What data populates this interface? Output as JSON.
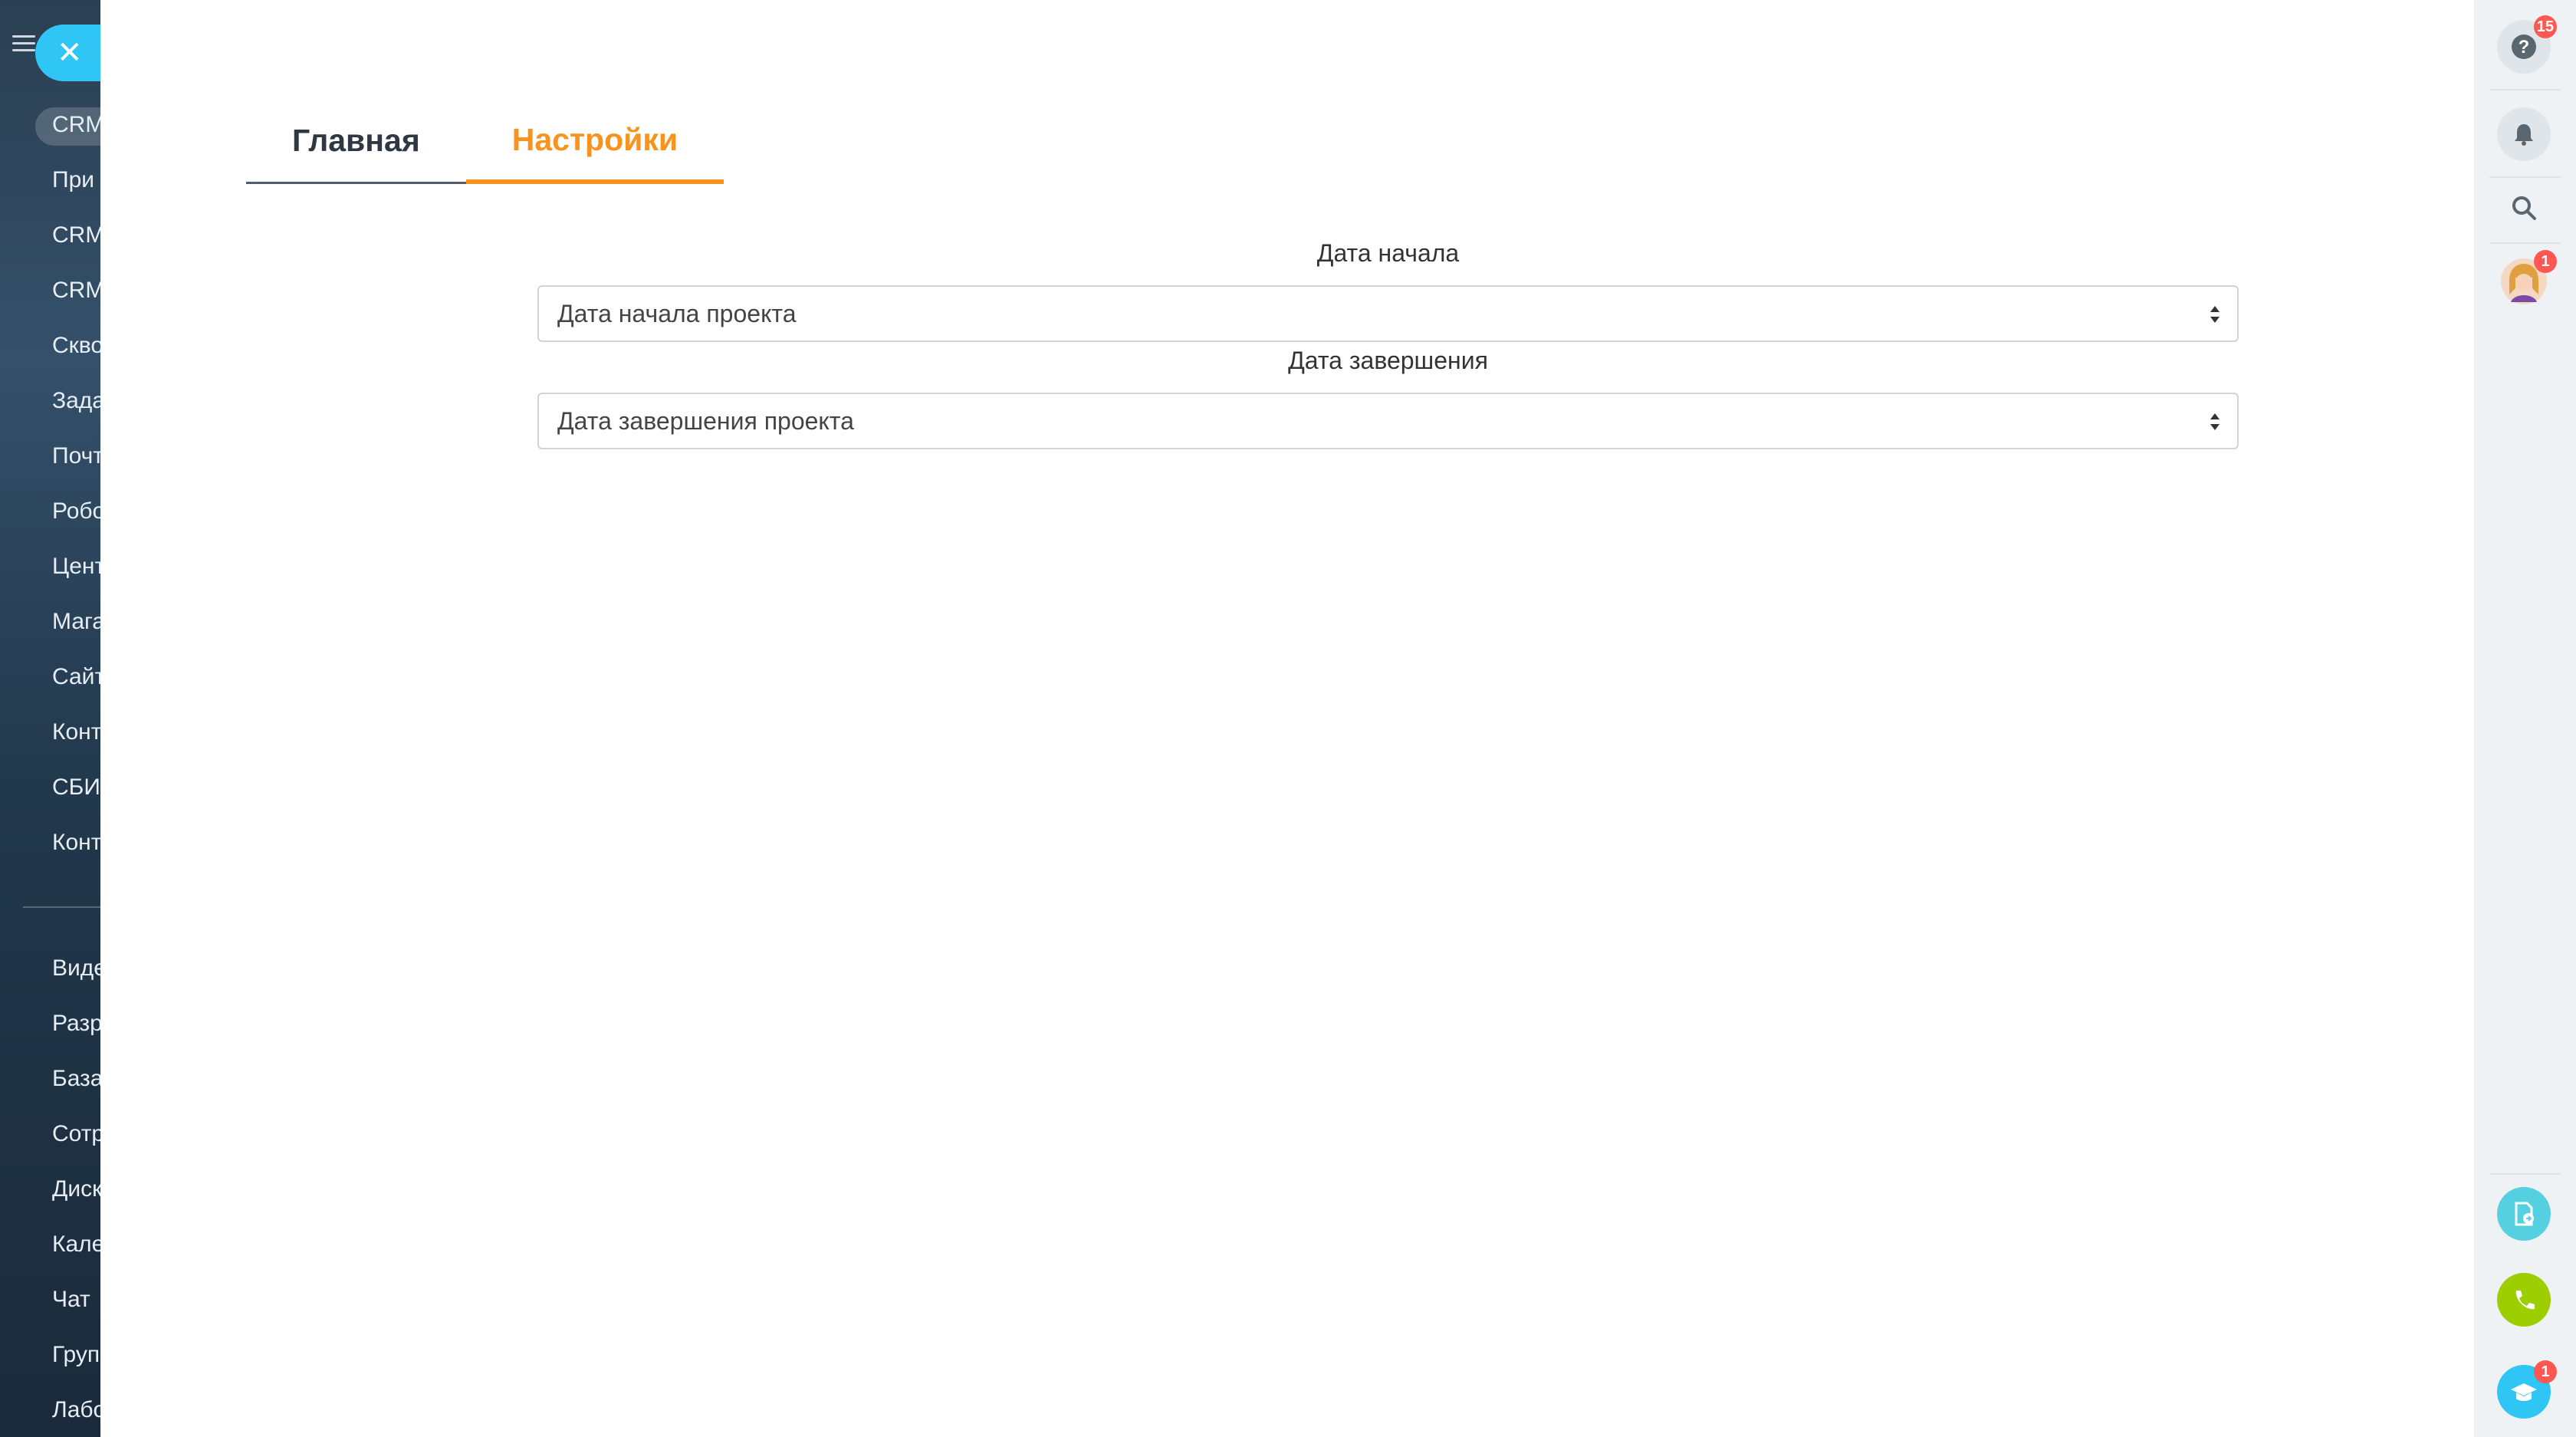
{
  "sidebar": {
    "items": [
      {
        "label": "CRM"
      },
      {
        "label": "При"
      },
      {
        "label": "CRM"
      },
      {
        "label": "CRM"
      },
      {
        "label": "Скво"
      },
      {
        "label": "Зада"
      },
      {
        "label": "Почт"
      },
      {
        "label": "Робо"
      },
      {
        "label": "Цент"
      },
      {
        "label": "Мага"
      },
      {
        "label": "Сайт"
      },
      {
        "label": "Конт"
      },
      {
        "label": "СБИ"
      },
      {
        "label": "Конт"
      },
      {
        "label": "Виде"
      },
      {
        "label": "Разр"
      },
      {
        "label": "База"
      },
      {
        "label": "Сотр"
      },
      {
        "label": "Диск"
      },
      {
        "label": "Кале"
      },
      {
        "label": "Чат"
      },
      {
        "label": "Груп"
      },
      {
        "label": "Лабо"
      }
    ]
  },
  "panel": {
    "close_icon": "close-icon",
    "tabs": [
      {
        "label": "Главная",
        "active": false
      },
      {
        "label": "Настройки",
        "active": true
      }
    ],
    "fields": [
      {
        "label": "Дата начала",
        "value": "Дата начала проекта"
      },
      {
        "label": "Дата завершения",
        "value": "Дата завершения проекта"
      }
    ]
  },
  "right_rail": {
    "help_badge": "15",
    "avatar_badge": "1",
    "education_badge": "1",
    "icons": [
      "help-icon",
      "bell-icon",
      "search-icon",
      "avatar",
      "document-share-icon",
      "phone-icon",
      "graduation-cap-icon"
    ]
  },
  "colors": {
    "accent_orange": "#f7931e",
    "close_blue": "#2fc6f6",
    "badge_red": "#ff5752",
    "phone_green": "#9dcf00"
  }
}
